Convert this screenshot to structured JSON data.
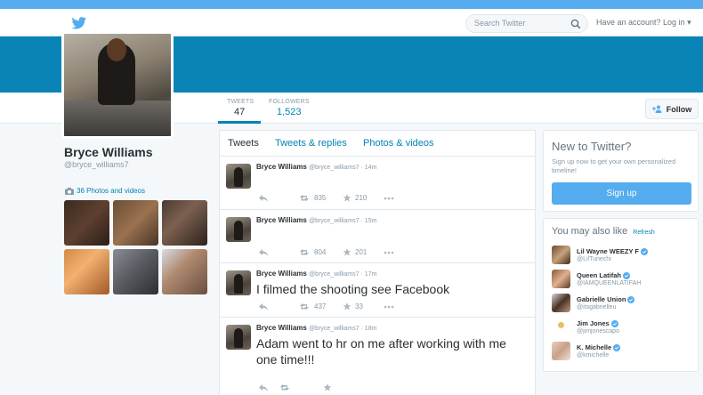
{
  "header": {
    "search_placeholder": "Search Twitter",
    "login_text": "Have an account? Log in ▾"
  },
  "profile": {
    "name": "Bryce Williams",
    "handle": "@bryce_williams7",
    "photos_label": "36 Photos and videos",
    "follow_label": "Follow"
  },
  "stats": {
    "tweets_label": "TWEETS",
    "tweets_value": "47",
    "followers_label": "FOLLOWERS",
    "followers_value": "1,523"
  },
  "tabs": [
    "Tweets",
    "Tweets & replies",
    "Photos & videos"
  ],
  "tweets": [
    {
      "name": "Bryce Williams",
      "meta": "@bryce_williams7 · 14m",
      "text": "",
      "retweets": "835",
      "favorites": "210"
    },
    {
      "name": "Bryce Williams",
      "meta": "@bryce_williams7 · 15m",
      "text": "",
      "retweets": "804",
      "favorites": "201"
    },
    {
      "name": "Bryce Williams",
      "meta": "@bryce_williams7 · 17m",
      "text": "I filmed the shooting see Facebook",
      "retweets": "437",
      "favorites": "33"
    },
    {
      "name": "Bryce Williams",
      "meta": "@bryce_williams7 · 18m",
      "text": "Adam went to hr on me after working with me one time!!!",
      "retweets": "",
      "favorites": ""
    }
  ],
  "new_to_twitter": {
    "title": "New to Twitter?",
    "subtitle": "Sign up now to get your own personalized timeline!",
    "signup_label": "Sign up"
  },
  "suggestions": {
    "title": "You may also like",
    "refresh_label": "Refresh",
    "items": [
      {
        "name": "Lil Wayne WEEZY F",
        "handle": "@LilTunechi"
      },
      {
        "name": "Queen Latifah",
        "handle": "@IAMQUEENLATIFAH"
      },
      {
        "name": "Gabrielle Union",
        "handle": "@itsgabrielleu"
      },
      {
        "name": "Jim Jones",
        "handle": "@jimjonescapo"
      },
      {
        "name": "K. Michelle",
        "handle": "@kmichelle"
      }
    ]
  },
  "colors": {
    "brand_blue": "#55acee",
    "banner": "#0a84b7",
    "link": "#0084b4"
  },
  "icons": [
    "twitter-bird-icon",
    "search-icon",
    "follow-person-icon",
    "camera-icon",
    "reply-icon",
    "retweet-icon",
    "favorite-star-icon",
    "more-dots-icon",
    "verified-icon"
  ]
}
